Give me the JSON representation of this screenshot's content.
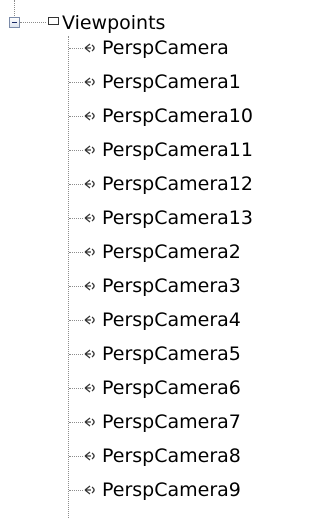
{
  "tree": {
    "root": {
      "label": "Viewpoints",
      "expanded": true,
      "icon": "folder-icon"
    },
    "children": [
      {
        "label": "PerspCamera",
        "icon": "camera-icon"
      },
      {
        "label": "PerspCamera1",
        "icon": "camera-icon"
      },
      {
        "label": "PerspCamera10",
        "icon": "camera-icon"
      },
      {
        "label": "PerspCamera11",
        "icon": "camera-icon"
      },
      {
        "label": "PerspCamera12",
        "icon": "camera-icon"
      },
      {
        "label": "PerspCamera13",
        "icon": "camera-icon"
      },
      {
        "label": "PerspCamera2",
        "icon": "camera-icon"
      },
      {
        "label": "PerspCamera3",
        "icon": "camera-icon"
      },
      {
        "label": "PerspCamera4",
        "icon": "camera-icon"
      },
      {
        "label": "PerspCamera5",
        "icon": "camera-icon"
      },
      {
        "label": "PerspCamera6",
        "icon": "camera-icon"
      },
      {
        "label": "PerspCamera7",
        "icon": "camera-icon"
      },
      {
        "label": "PerspCamera8",
        "icon": "camera-icon"
      },
      {
        "label": "PerspCamera9",
        "icon": "camera-icon"
      }
    ]
  },
  "colors": {
    "background": "#ffffff",
    "text": "#000000",
    "connector": "#8c8c8c",
    "icon": "#333333"
  }
}
